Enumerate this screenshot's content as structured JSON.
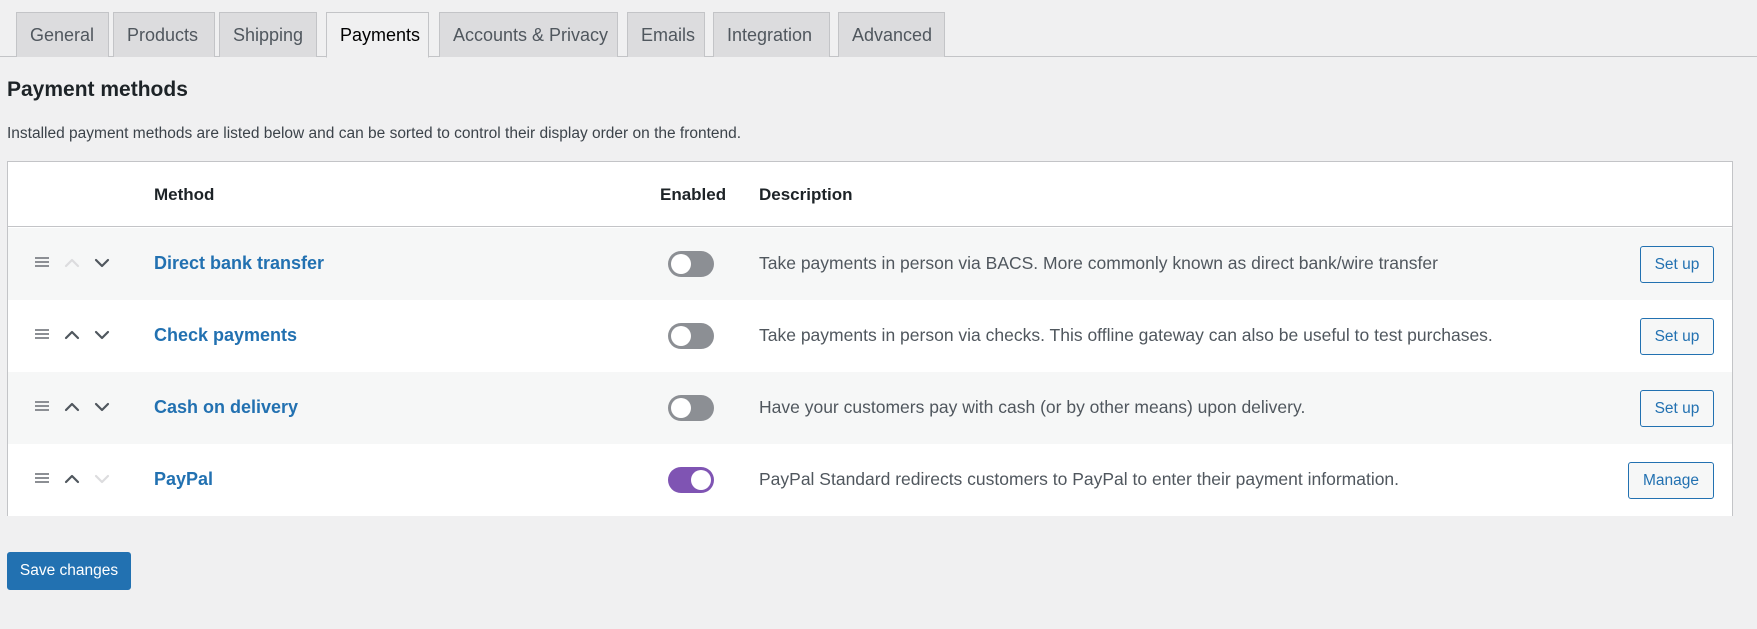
{
  "tabs": [
    {
      "label": "General",
      "active": false
    },
    {
      "label": "Products",
      "active": false
    },
    {
      "label": "Shipping",
      "active": false
    },
    {
      "label": "Payments",
      "active": true
    },
    {
      "label": "Accounts & Privacy",
      "active": false
    },
    {
      "label": "Emails",
      "active": false
    },
    {
      "label": "Integration",
      "active": false
    },
    {
      "label": "Advanced",
      "active": false
    }
  ],
  "page": {
    "title": "Payment methods",
    "intro": "Installed payment methods are listed below and can be sorted to control their display order on the frontend."
  },
  "table": {
    "headers": {
      "method": "Method",
      "enabled": "Enabled",
      "description": "Description"
    },
    "rows": [
      {
        "method": "Direct bank transfer",
        "enabled": false,
        "description": "Take payments in person via BACS. More commonly known as direct bank/wire transfer",
        "action": "Set up",
        "up_enabled": false,
        "down_enabled": true
      },
      {
        "method": "Check payments",
        "enabled": false,
        "description": "Take payments in person via checks. This offline gateway can also be useful to test purchases.",
        "action": "Set up",
        "up_enabled": true,
        "down_enabled": true
      },
      {
        "method": "Cash on delivery",
        "enabled": false,
        "description": "Have your customers pay with cash (or by other means) upon delivery.",
        "action": "Set up",
        "up_enabled": true,
        "down_enabled": true
      },
      {
        "method": "PayPal",
        "enabled": true,
        "description": "PayPal Standard redirects customers to PayPal to enter their payment information.",
        "action": "Manage",
        "up_enabled": true,
        "down_enabled": false
      }
    ]
  },
  "footer": {
    "save_label": "Save changes"
  },
  "colors": {
    "link": "#2271b1",
    "toggle_on": "#7f54b3",
    "toggle_off": "#8c8f94",
    "arrow_active": "#50575e",
    "arrow_disabled": "#dcdcde"
  },
  "icons": {
    "drag_handle": "drag-handle-icon",
    "move_up": "chevron-up-icon",
    "move_down": "chevron-down-icon"
  }
}
